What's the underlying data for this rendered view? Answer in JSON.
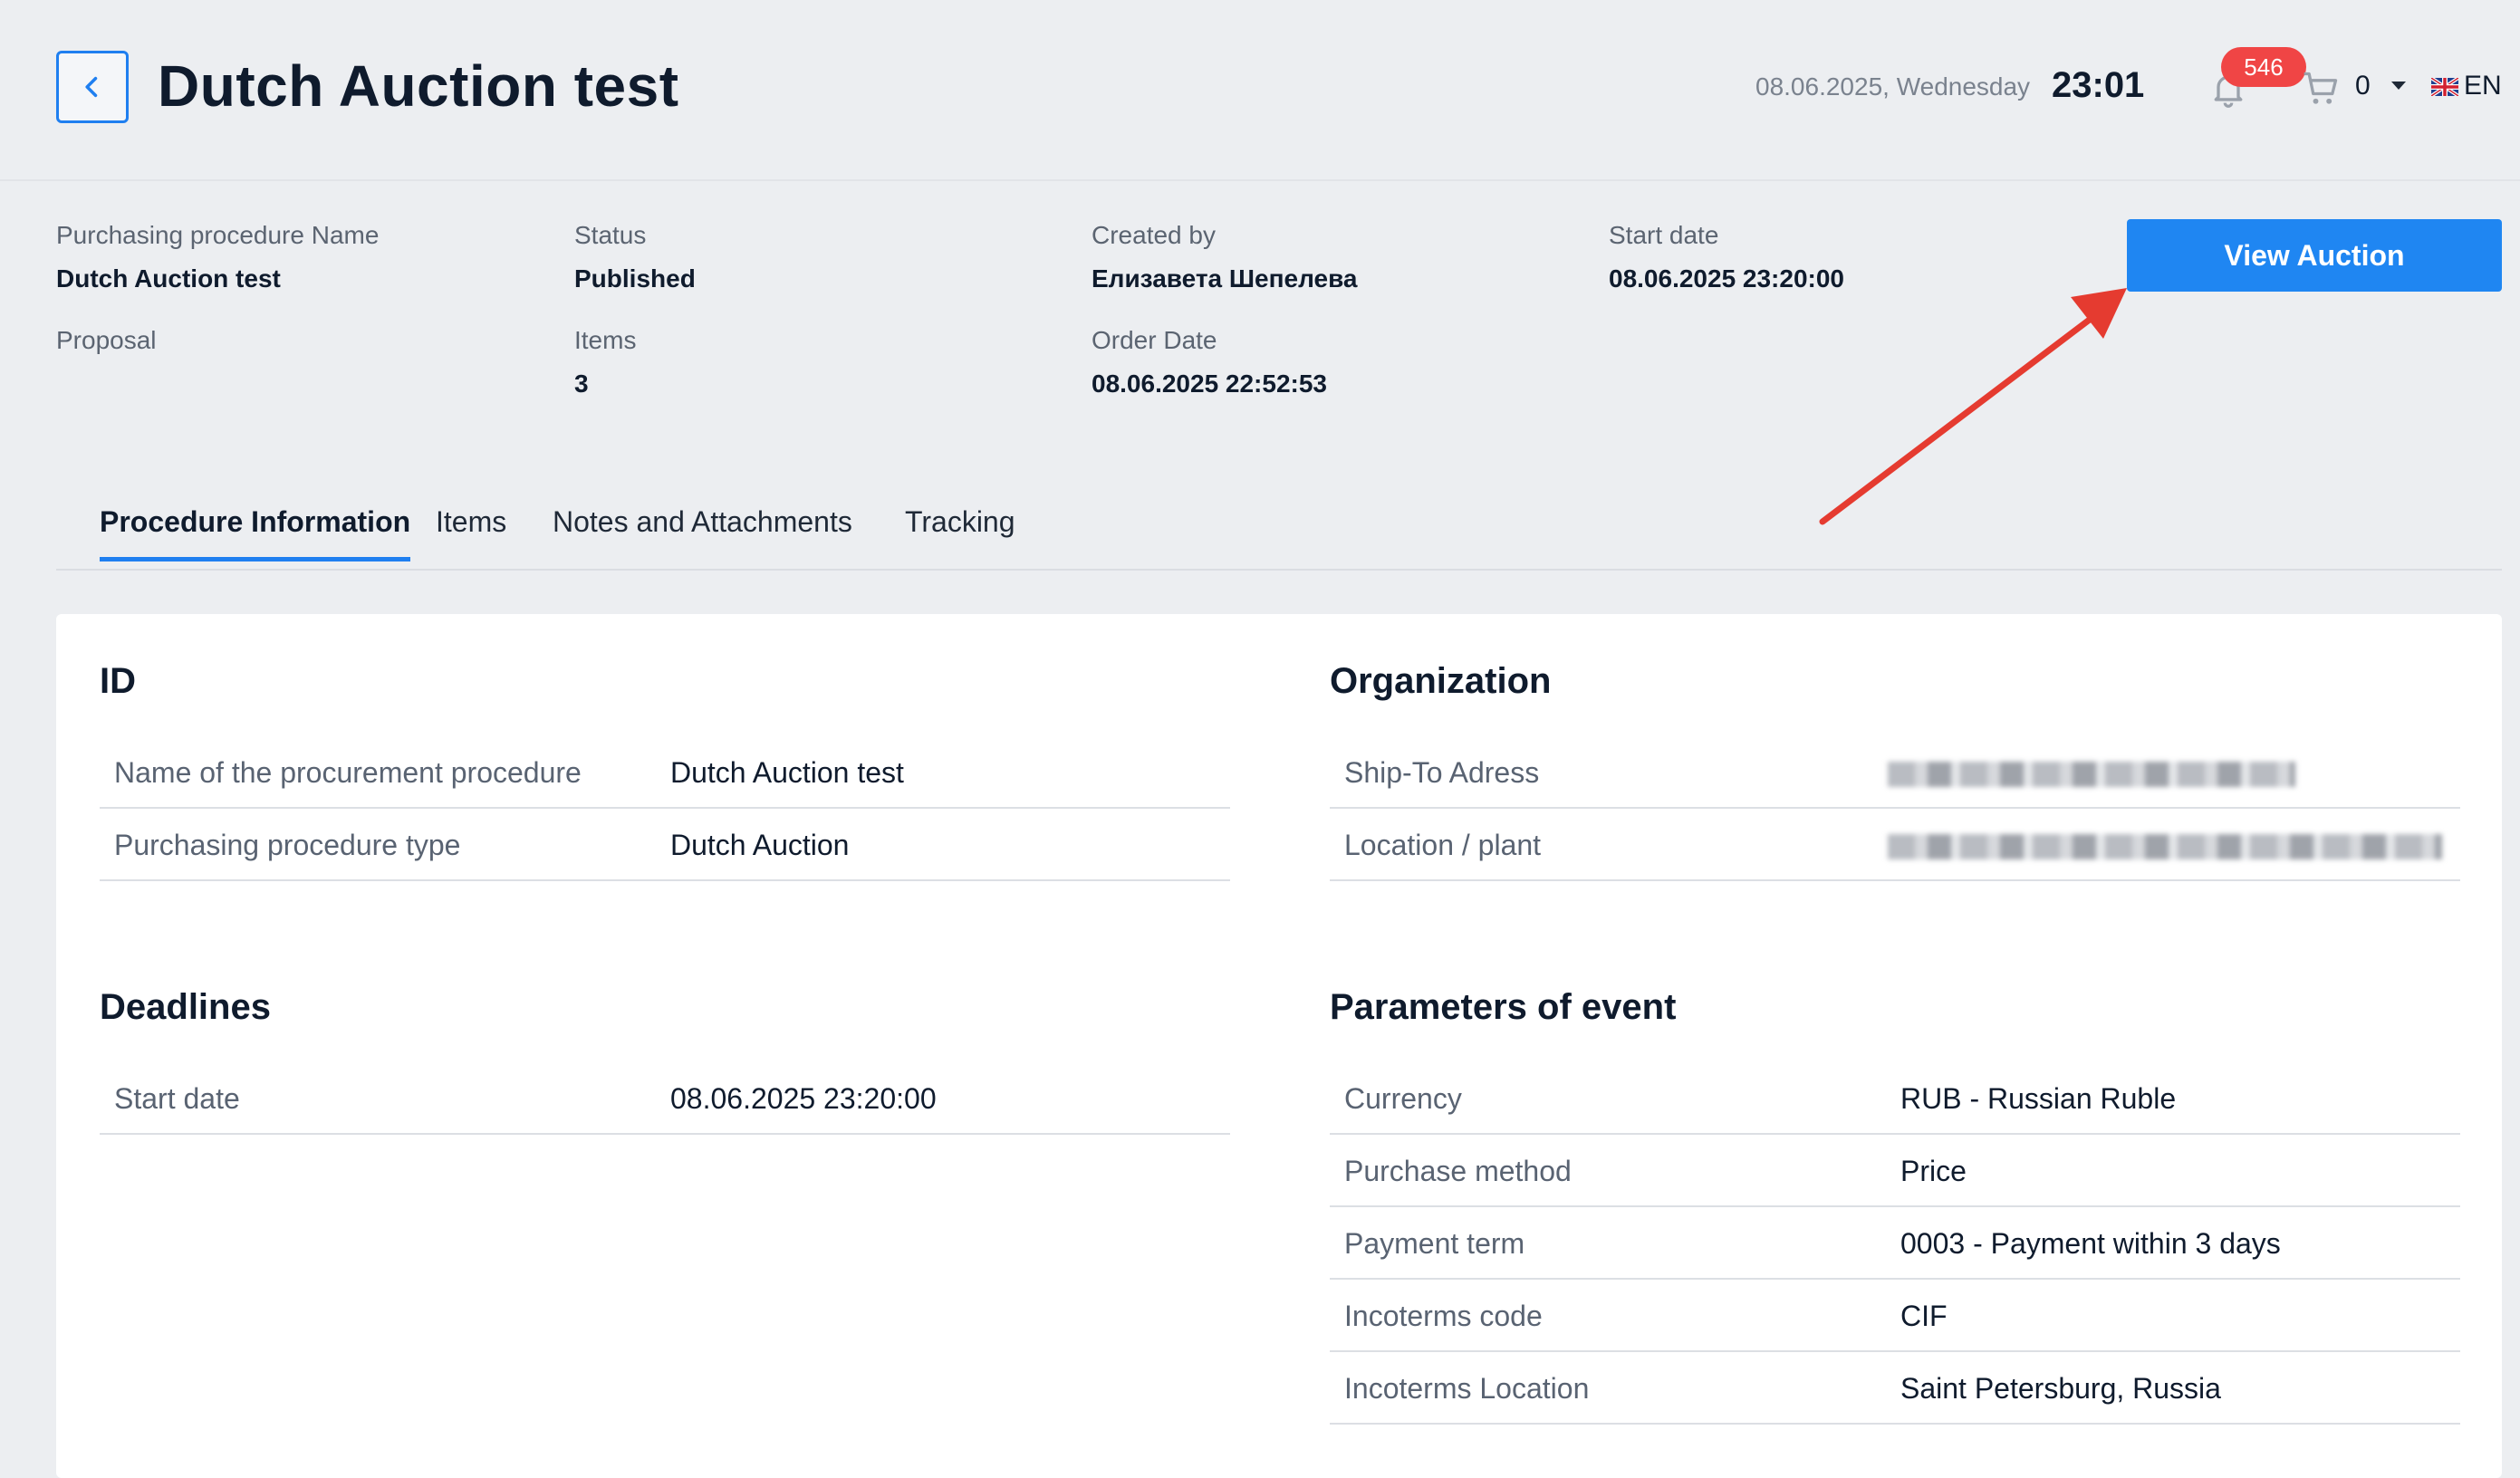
{
  "header": {
    "title": "Dutch Auction test",
    "date": "08.06.2025, Wednesday",
    "time": "23:01",
    "notifications_count": "546",
    "cart_count": "0",
    "language": "EN"
  },
  "summary": {
    "procedure_name_label": "Purchasing procedure Name",
    "procedure_name_value": "Dutch Auction test",
    "proposal_label": "Proposal",
    "status_label": "Status",
    "status_value": "Published",
    "items_label": "Items",
    "items_value": "3",
    "created_by_label": "Created by",
    "created_by_value": "Елизавета Шепелева",
    "order_date_label": "Order Date",
    "order_date_value": "08.06.2025 22:52:53",
    "start_date_label": "Start date",
    "start_date_value": "08.06.2025 23:20:00",
    "view_auction_label": "View Auction"
  },
  "tabs": [
    {
      "label": "Procedure Information"
    },
    {
      "label": "Items"
    },
    {
      "label": "Notes and Attachments"
    },
    {
      "label": "Tracking"
    }
  ],
  "id_section": {
    "title": "ID",
    "rows": [
      {
        "label": "Name of the procurement procedure",
        "value": "Dutch Auction test"
      },
      {
        "label": "Purchasing procedure type",
        "value": "Dutch Auction"
      }
    ]
  },
  "organization_section": {
    "title": "Organization",
    "rows": [
      {
        "label": "Ship-To Adress"
      },
      {
        "label": "Location / plant"
      }
    ]
  },
  "deadlines_section": {
    "title": "Deadlines",
    "rows": [
      {
        "label": "Start date",
        "value": "08.06.2025 23:20:00"
      }
    ]
  },
  "parameters_section": {
    "title": "Parameters of event",
    "rows": [
      {
        "label": "Currency",
        "value": "RUB - Russian Ruble"
      },
      {
        "label": "Purchase method",
        "value": "Price"
      },
      {
        "label": "Payment term",
        "value": "0003 - Payment within 3 days"
      },
      {
        "label": "Incoterms code",
        "value": "CIF"
      },
      {
        "label": "Incoterms Location",
        "value": "Saint Petersburg, Russia"
      }
    ]
  },
  "colors": {
    "accent": "#1f86f2",
    "badge": "#f04545",
    "annotation_arrow": "#e53b30"
  }
}
